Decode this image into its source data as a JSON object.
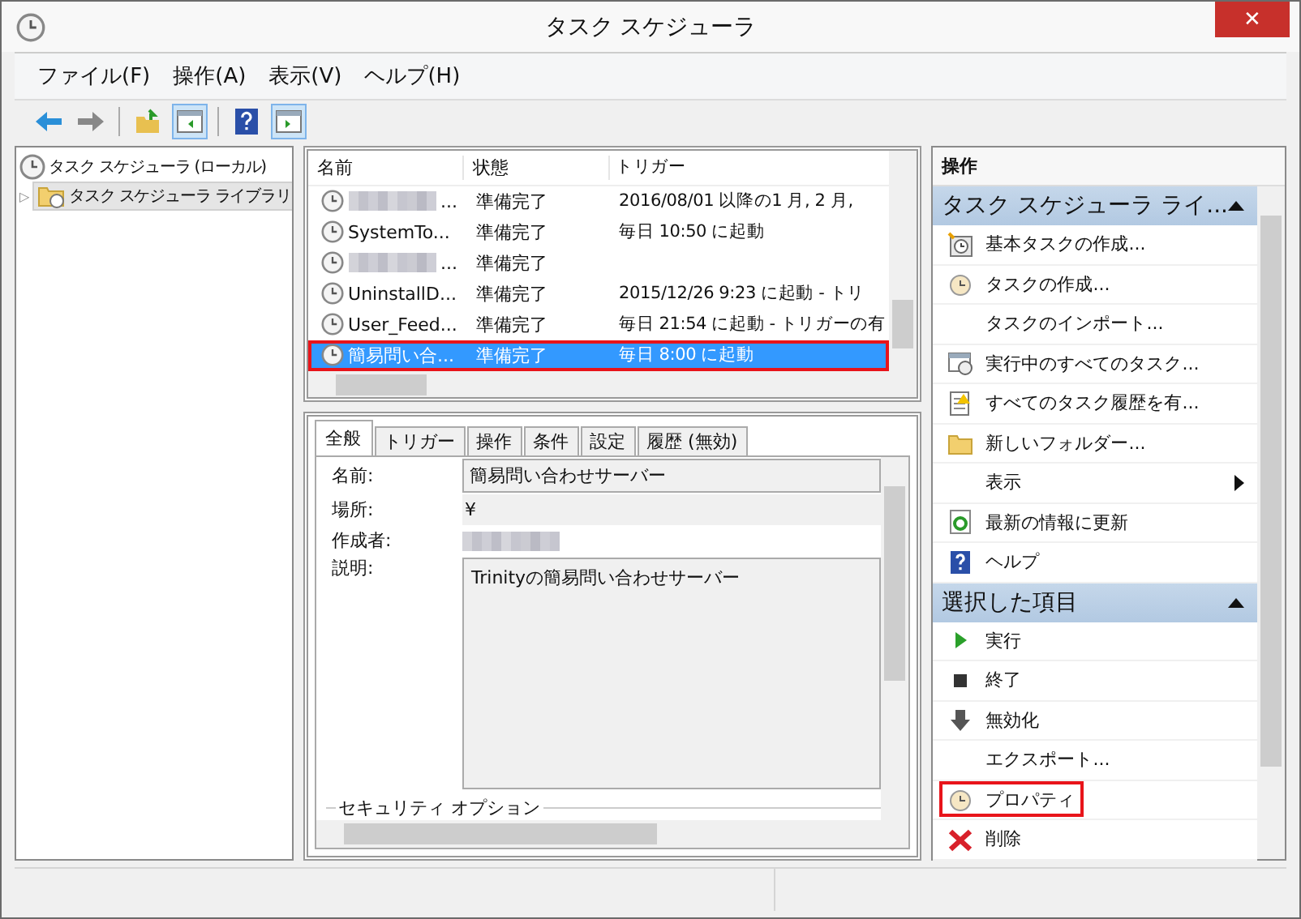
{
  "window": {
    "title": "タスク スケジューラ",
    "close": "✕"
  },
  "menu": [
    "ファイル(F)",
    "操作(A)",
    "表示(V)",
    "ヘルプ(H)"
  ],
  "tree": {
    "label": "タスク スケジューラ (ローカル)",
    "children": [
      {
        "label": "タスク スケジューラ ライブラリ",
        "selected": true,
        "expander": "▷"
      }
    ]
  },
  "task_list": {
    "columns": [
      "名前",
      "状態",
      "トリガー"
    ],
    "rows": [
      {
        "name": "...",
        "redacted": true,
        "status": "準備完了",
        "trigger": "2016/08/01 以降の1 月, 2 月,",
        "selected": false,
        "highlighted": false
      },
      {
        "name": "SystemTo...",
        "redacted": false,
        "status": "準備完了",
        "trigger": "毎日 10:50 に起動",
        "selected": false,
        "highlighted": false
      },
      {
        "name": "...",
        "redacted": true,
        "status": "準備完了",
        "trigger": "",
        "selected": false,
        "highlighted": false
      },
      {
        "name": "UninstallD...",
        "redacted": false,
        "status": "準備完了",
        "trigger": "2015/12/26 9:23 に起動 - トリ",
        "selected": false,
        "highlighted": false
      },
      {
        "name": "User_Feed...",
        "redacted": false,
        "status": "準備完了",
        "trigger": "毎日 21:54 に起動 - トリガーの有",
        "selected": false,
        "highlighted": false
      },
      {
        "name": "簡易問い合...",
        "redacted": false,
        "status": "準備完了",
        "trigger": "毎日 8:00 に起動",
        "selected": true,
        "highlighted": true
      }
    ]
  },
  "detail_tabs": [
    {
      "label": "全般",
      "selected": true
    },
    {
      "label": "トリガー",
      "selected": false
    },
    {
      "label": "操作",
      "selected": false
    },
    {
      "label": "条件",
      "selected": false
    },
    {
      "label": "設定",
      "selected": false
    },
    {
      "label": "履歴 (無効)",
      "selected": false
    }
  ],
  "general": {
    "name_label": "名前:",
    "name_value": "簡易問い合わせサーバー",
    "location_label": "場所:",
    "location_value": "¥",
    "author_label": "作成者:",
    "author_redacted": true,
    "description_label": "説明:",
    "description_value": "Trinityの簡易問い合わせサーバー",
    "security_group": "セキュリティ オプション"
  },
  "actions_pane": {
    "title": "操作",
    "sections": [
      {
        "title": "タスク スケジューラ ライ...",
        "expanded": true,
        "items": [
          {
            "label": "基本タスクの作成...",
            "highlighted": false,
            "submenu": false
          },
          {
            "label": "タスクの作成...",
            "highlighted": false,
            "submenu": false
          },
          {
            "label": "タスクのインポート...",
            "highlighted": false,
            "submenu": false
          },
          {
            "label": "実行中のすべてのタスク...",
            "highlighted": false,
            "submenu": false
          },
          {
            "label": "すべてのタスク履歴を有...",
            "highlighted": false,
            "submenu": false
          },
          {
            "label": "新しいフォルダー...",
            "highlighted": false,
            "submenu": false
          },
          {
            "label": "表示",
            "highlighted": false,
            "submenu": true
          },
          {
            "label": "最新の情報に更新",
            "highlighted": false,
            "submenu": false
          },
          {
            "label": "ヘルプ",
            "highlighted": false,
            "submenu": false
          }
        ]
      },
      {
        "title": "選択した項目",
        "expanded": true,
        "items": [
          {
            "label": "実行",
            "highlighted": false,
            "submenu": false
          },
          {
            "label": "終了",
            "highlighted": false,
            "submenu": false
          },
          {
            "label": "無効化",
            "highlighted": false,
            "submenu": false
          },
          {
            "label": "エクスポート...",
            "highlighted": false,
            "submenu": false
          },
          {
            "label": "プロパティ",
            "highlighted": true,
            "submenu": false
          },
          {
            "label": "削除",
            "highlighted": false,
            "submenu": false
          }
        ]
      }
    ]
  }
}
